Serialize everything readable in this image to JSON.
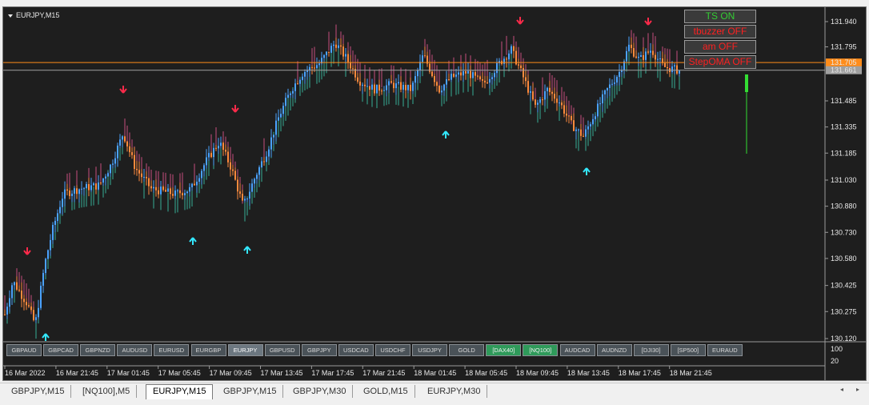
{
  "chart": {
    "symbol_title": "EURJPY,M15",
    "price_axis_labels": [
      {
        "text": "131.940",
        "price": 131.94
      },
      {
        "text": "131.795",
        "price": 131.795
      },
      {
        "text": "131.485",
        "price": 131.485
      },
      {
        "text": "131.335",
        "price": 131.335
      },
      {
        "text": "131.185",
        "price": 131.185
      },
      {
        "text": "131.030",
        "price": 131.03
      },
      {
        "text": "130.880",
        "price": 130.88
      },
      {
        "text": "130.730",
        "price": 130.73
      },
      {
        "text": "130.580",
        "price": 130.58
      },
      {
        "text": "130.425",
        "price": 130.425
      },
      {
        "text": "130.275",
        "price": 130.275
      },
      {
        "text": "130.120",
        "price": 130.12
      }
    ],
    "price_tags": [
      {
        "text": "131.705",
        "price": 131.705,
        "color": "#ff8c1a"
      },
      {
        "text": "131.661",
        "price": 131.661,
        "color": "#a0a0a0"
      }
    ],
    "indicator_scale": [
      "100",
      "20"
    ],
    "time_labels": [
      "16 Mar 2022",
      "16 Mar 21:45",
      "17 Mar 01:45",
      "17 Mar 05:45",
      "17 Mar 09:45",
      "17 Mar 13:45",
      "17 Mar 17:45",
      "17 Mar 21:45",
      "18 Mar 01:45",
      "18 Mar 05:45",
      "18 Mar 09:45",
      "18 Mar 13:45",
      "18 Mar 17:45",
      "18 Mar 21:45"
    ],
    "colors": {
      "background": "#1e1e1e",
      "bull_candle": "#4aa3ff",
      "bear_candle": "#ff8a3d",
      "bull_histogram": "#3fe0c0",
      "bear_histogram": "#ff5fa0",
      "arrow_up": "#33e8ff",
      "arrow_down": "#ff2a4a",
      "ask_line": "#ff8c1a",
      "bid_line": "#8a8a8a"
    }
  },
  "panel": {
    "buttons": [
      {
        "label": "TS ON",
        "color": "#33cc33"
      },
      {
        "label": "tbuzzer OFF",
        "color": "#ff2020"
      },
      {
        "label": "am OFF",
        "color": "#ff2020"
      },
      {
        "label": "StepOMA OFF",
        "color": "#ff2020"
      }
    ]
  },
  "symbol_buttons": [
    {
      "label": "GBPAUD",
      "state": "normal"
    },
    {
      "label": "GBPCAD",
      "state": "normal"
    },
    {
      "label": "GBPNZD",
      "state": "normal"
    },
    {
      "label": "AUDUSD",
      "state": "normal"
    },
    {
      "label": "EURUSD",
      "state": "normal"
    },
    {
      "label": "EURGBP",
      "state": "normal"
    },
    {
      "label": "EURJPY",
      "state": "active"
    },
    {
      "label": "GBPUSD",
      "state": "normal"
    },
    {
      "label": "GBPJPY",
      "state": "normal"
    },
    {
      "label": "USDCAD",
      "state": "normal"
    },
    {
      "label": "USDCHF",
      "state": "normal"
    },
    {
      "label": "USDJPY",
      "state": "normal"
    },
    {
      "label": "GOLD",
      "state": "normal"
    },
    {
      "label": "[DAX40]",
      "state": "green"
    },
    {
      "label": "[NQ100]",
      "state": "green"
    },
    {
      "label": "AUDCAD",
      "state": "normal"
    },
    {
      "label": "AUDNZD",
      "state": "normal"
    },
    {
      "label": "[DJI30]",
      "state": "normal"
    },
    {
      "label": "[SP500]",
      "state": "normal"
    },
    {
      "label": "EURAUD",
      "state": "normal"
    }
  ],
  "tabs": [
    {
      "label": "GBPJPY,M15",
      "active": false
    },
    {
      "label": "[NQ100],M5",
      "active": false
    },
    {
      "label": "EURJPY,M15",
      "active": true
    },
    {
      "label": "GBPJPY,M15",
      "active": false
    },
    {
      "label": "GBPJPY,M30",
      "active": false
    },
    {
      "label": "GOLD,M15",
      "active": false
    },
    {
      "label": "EURJPY,M30",
      "active": false
    }
  ],
  "nav": {
    "left": "◂",
    "right": "▸"
  }
}
